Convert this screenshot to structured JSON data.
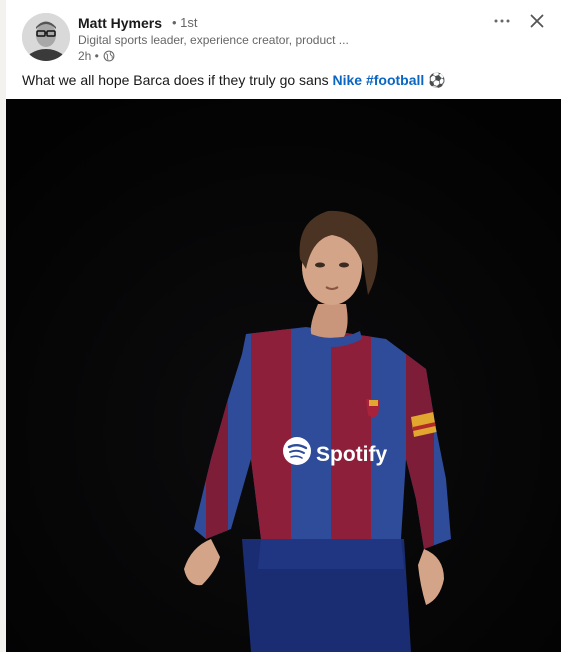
{
  "post": {
    "author": {
      "name": "Matt Hymers",
      "degree": "• 1st",
      "headline": "Digital sports leader, experience creator, product ...",
      "time": "2h •",
      "visibility_icon": "globe-icon"
    },
    "actions": {
      "more_icon": "ellipsis-icon",
      "close_icon": "close-icon"
    },
    "text": {
      "prefix": "What we all hope Barca does if they truly go sans ",
      "mention": "Nike",
      "hashtag": "#football",
      "emoji": "⚽"
    },
    "image": {
      "sponsor_text": "Spotify",
      "kit_colors": {
        "blue": "#2f4f9f",
        "red": "#8e1f3a",
        "armband": "#e2a72e"
      }
    }
  }
}
